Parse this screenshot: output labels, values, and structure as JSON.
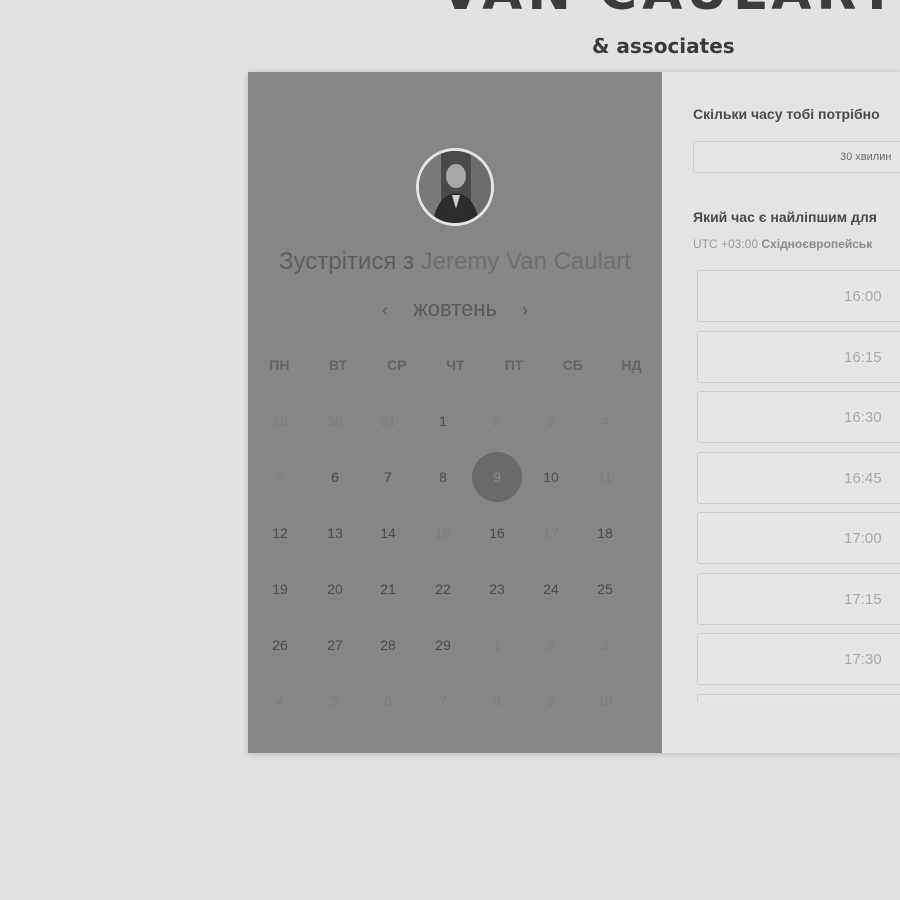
{
  "brand": {
    "name": "VAN CAULART",
    "subtitle": "& associates"
  },
  "meeting": {
    "title_prefix": "Зустрітися з",
    "host_name": "Jeremy Van Caulart"
  },
  "calendar": {
    "month": "жовтень",
    "prev_icon": "chevron-left-icon",
    "next_icon": "chevron-right-icon",
    "weekdays": [
      "ПН",
      "ВТ",
      "СР",
      "ЧТ",
      "ПТ",
      "СБ",
      "НД"
    ],
    "weeks": [
      [
        {
          "d": "29",
          "s": "muted"
        },
        {
          "d": "30",
          "s": "muted"
        },
        {
          "d": "31",
          "s": "muted"
        },
        {
          "d": "1",
          "s": "avail"
        },
        {
          "d": "2",
          "s": "muted"
        },
        {
          "d": "3",
          "s": "muted"
        },
        {
          "d": "4",
          "s": "muted"
        }
      ],
      [
        {
          "d": "5",
          "s": "muted"
        },
        {
          "d": "6",
          "s": "avail"
        },
        {
          "d": "7",
          "s": "avail"
        },
        {
          "d": "8",
          "s": "avail"
        },
        {
          "d": "9",
          "s": "sel"
        },
        {
          "d": "10",
          "s": "avail"
        },
        {
          "d": "11",
          "s": "muted"
        }
      ],
      [
        {
          "d": "12",
          "s": "avail"
        },
        {
          "d": "13",
          "s": "avail"
        },
        {
          "d": "14",
          "s": "avail"
        },
        {
          "d": "15",
          "s": "muted"
        },
        {
          "d": "16",
          "s": "avail"
        },
        {
          "d": "17",
          "s": "muted"
        },
        {
          "d": "18",
          "s": "avail"
        }
      ],
      [
        {
          "d": "19",
          "s": "avail"
        },
        {
          "d": "20",
          "s": "avail"
        },
        {
          "d": "21",
          "s": "avail"
        },
        {
          "d": "22",
          "s": "avail"
        },
        {
          "d": "23",
          "s": "avail"
        },
        {
          "d": "24",
          "s": "avail"
        },
        {
          "d": "25",
          "s": "avail"
        }
      ],
      [
        {
          "d": "26",
          "s": "avail"
        },
        {
          "d": "27",
          "s": "avail"
        },
        {
          "d": "28",
          "s": "avail"
        },
        {
          "d": "29",
          "s": "avail"
        },
        {
          "d": "1",
          "s": "muted"
        },
        {
          "d": "2",
          "s": "muted"
        },
        {
          "d": "3",
          "s": "muted"
        }
      ],
      [
        {
          "d": "4",
          "s": "muted"
        },
        {
          "d": "5",
          "s": "muted"
        },
        {
          "d": "6",
          "s": "muted"
        },
        {
          "d": "7",
          "s": "muted"
        },
        {
          "d": "8",
          "s": "muted"
        },
        {
          "d": "9",
          "s": "muted"
        },
        {
          "d": "10",
          "s": "muted"
        }
      ]
    ],
    "selected_day": "9"
  },
  "booking": {
    "duration_question": "Скільки часу тобі потрібно",
    "duration_value": "30 хвилин",
    "time_question": "Який час є найліпшим для",
    "timezone_offset": "UTC +03:00",
    "timezone_name": "Східноєвропейськ",
    "slots": [
      "16:00",
      "16:15",
      "16:30",
      "16:45",
      "17:00",
      "17:15",
      "17:30",
      ""
    ]
  },
  "colors": {
    "background": "#e2e2e2",
    "left_panel": "#868686",
    "selected_day": "#6a6a6a"
  }
}
